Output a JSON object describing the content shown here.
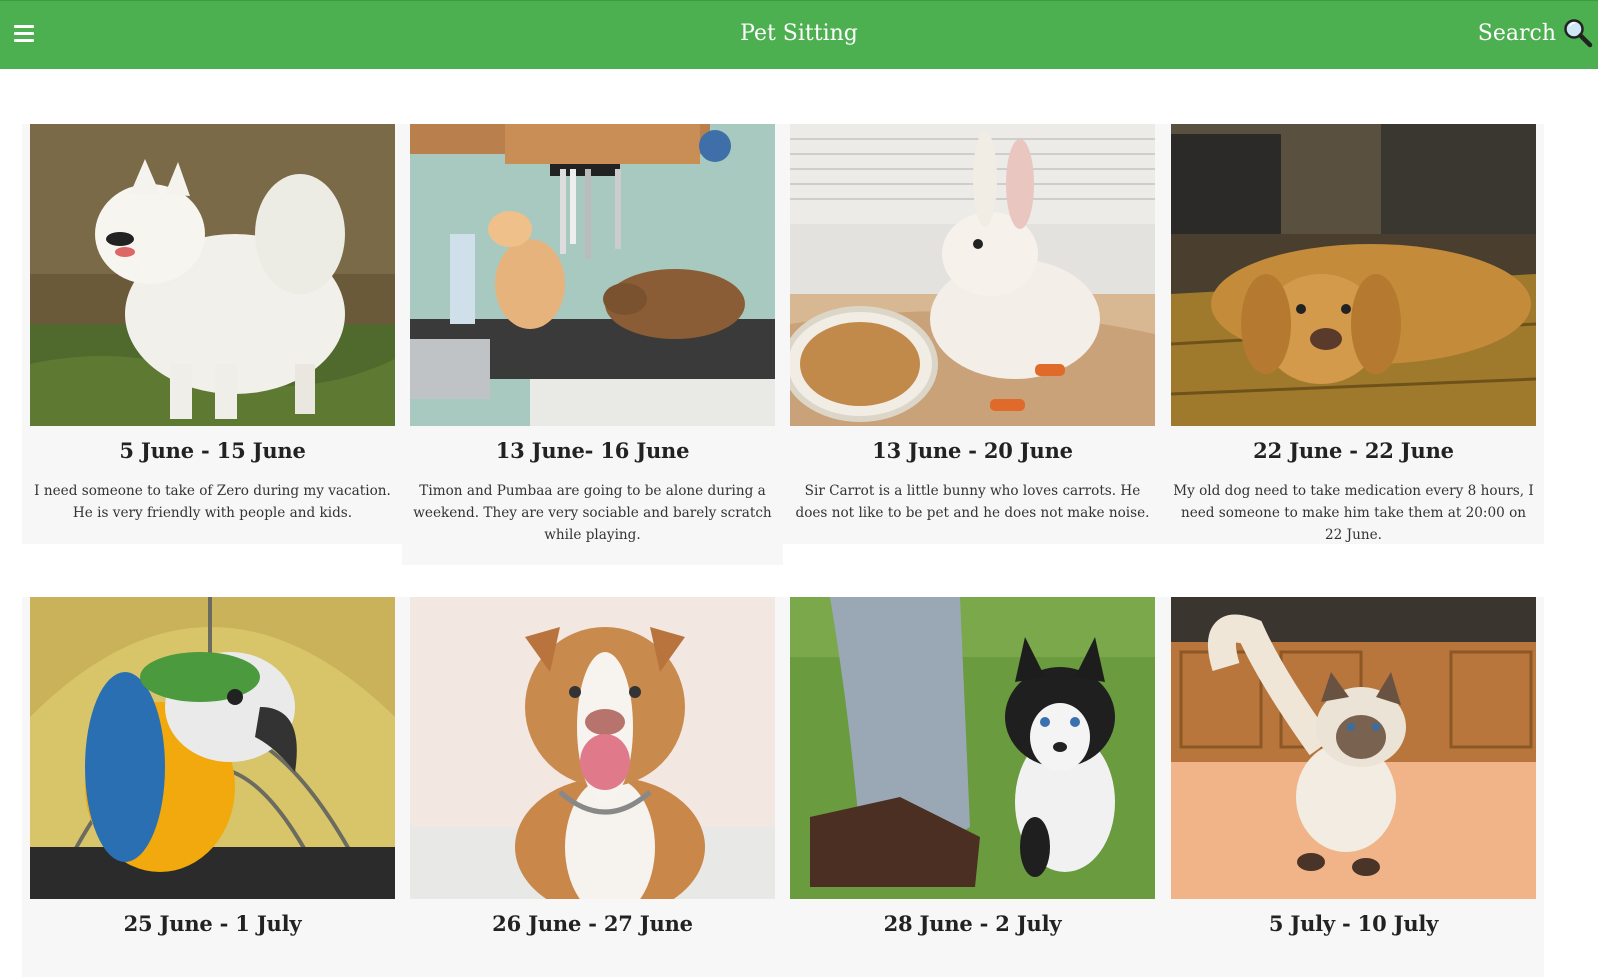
{
  "header": {
    "title": "Pet Sitting",
    "search_label": "Search",
    "background_color": "#4caf50"
  },
  "listings": [
    {
      "date": "5 June - 15 June",
      "description": "I need someone to take of Zero during my vacation. He is very friendly with people and kids.",
      "photo": "white-samoyed-dog-photo"
    },
    {
      "date": "13 June- 16 June",
      "description": "Timon and Pumbaa are going to be alone during a weekend. They are very sociable and barely scratch while playing.",
      "photo": "two-cats-on-kitchen-counter-photo"
    },
    {
      "date": "13 June - 20 June",
      "description": "Sir Carrot is a little bunny who loves carrots. He does not like to be pet and he does not make noise.",
      "photo": "white-rabbit-in-cage-photo"
    },
    {
      "date": "22 June - 22 June",
      "description": "My old dog need to take medication every 8 hours, I need someone to make him take them at 20:00 on 22 June.",
      "photo": "golden-retriever-lying-photo"
    },
    {
      "date": "25 June - 1 July",
      "description": "",
      "photo": "blue-yellow-macaw-photo"
    },
    {
      "date": "26 June - 27 June",
      "description": "",
      "photo": "pit-bull-dog-photo"
    },
    {
      "date": "28 June - 2 July",
      "description": "",
      "photo": "husky-puppy-photo"
    },
    {
      "date": "5 July - 10 July",
      "description": "",
      "photo": "himalayan-cat-photo"
    }
  ]
}
